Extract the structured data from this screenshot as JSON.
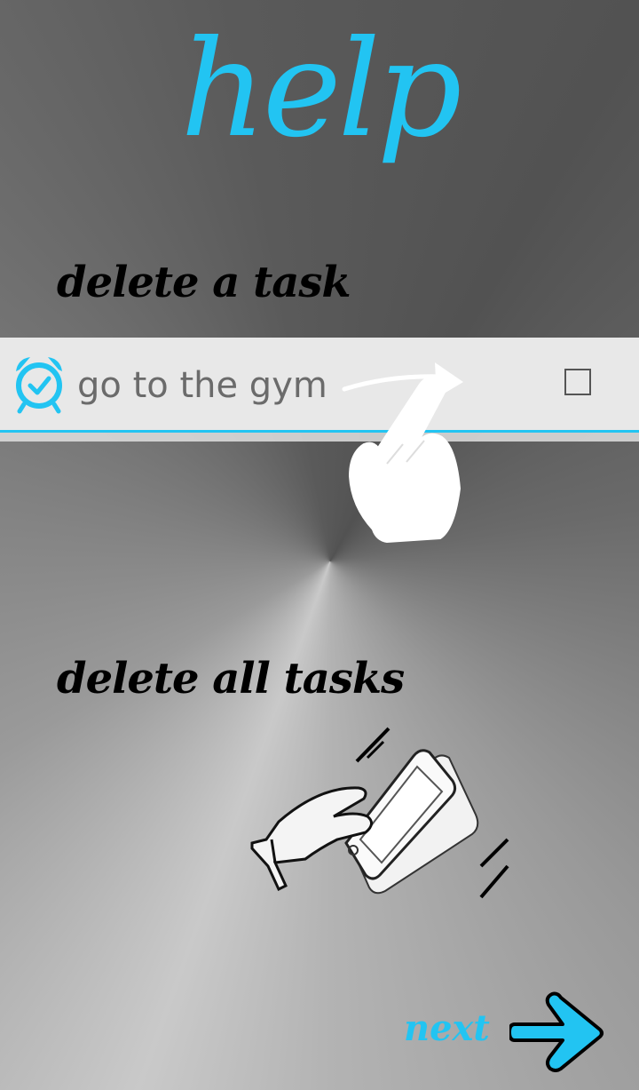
{
  "header": {
    "title": "help"
  },
  "sections": {
    "delete_task": {
      "title": "delete a task"
    },
    "delete_all": {
      "title": "delete all tasks"
    }
  },
  "task_example": {
    "text": "go to the gym",
    "icon": "alarm-clock-icon",
    "checked": false
  },
  "footer": {
    "next_label": "next",
    "next_icon": "arrow-right-icon"
  },
  "colors": {
    "accent": "#22c4f2",
    "row_bg": "#e8e8e8",
    "text_muted": "#6b6b6b"
  }
}
